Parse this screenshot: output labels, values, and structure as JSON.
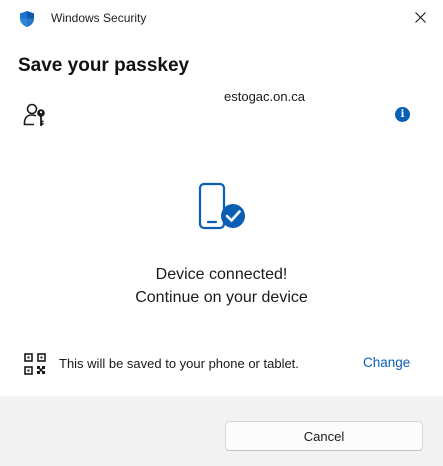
{
  "window": {
    "app_title": "Windows Security",
    "shield_icon": "shield-icon",
    "close_icon": "close-icon",
    "accent_color": "#0a5fb4"
  },
  "dialog": {
    "title": "Save your passkey",
    "site_name": "estogac.on.ca",
    "site_icon": "user-key-icon",
    "info_icon": "info-icon",
    "info_glyph": "i"
  },
  "status": {
    "icon": "phone-check-icon",
    "line1": "Device connected!",
    "line2": "Continue on your device"
  },
  "save_option": {
    "icon": "qr-code-icon",
    "text": "This will be saved to your phone or tablet.",
    "change_label": "Change"
  },
  "footer": {
    "cancel_label": "Cancel"
  }
}
